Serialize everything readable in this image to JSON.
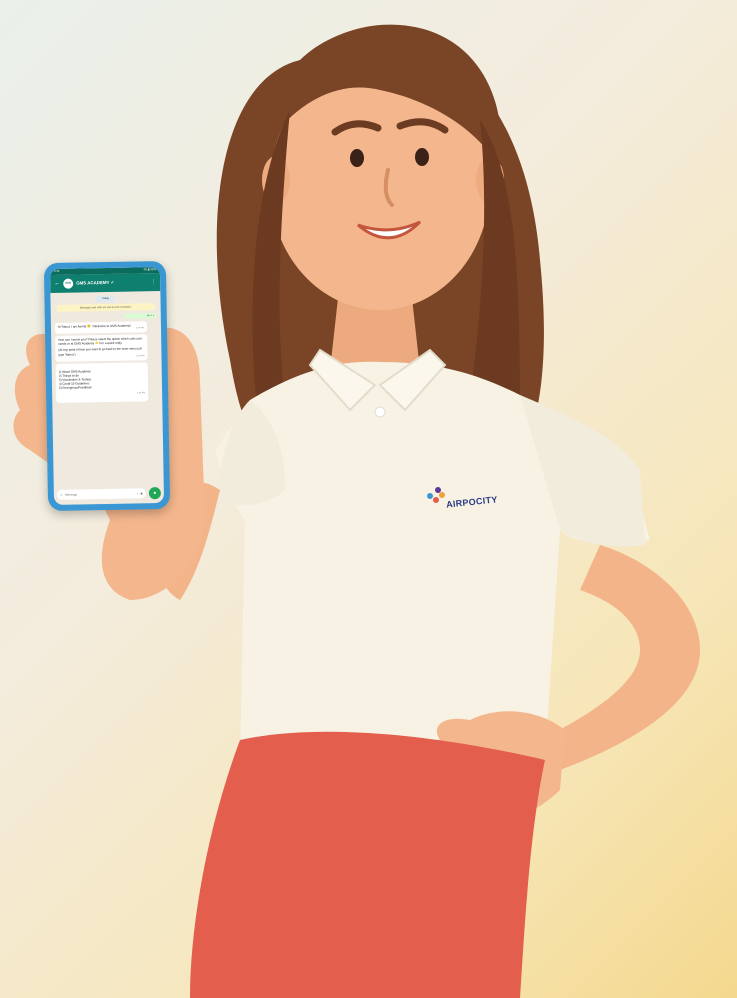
{
  "image": {
    "description_colors": {
      "background_start": "#eaf0ea",
      "background_end": "#f4d88e",
      "skin": "#f3b48a",
      "hair": "#7a4426",
      "shirt": "#f7f2e4",
      "skirt": "#e35e4c",
      "phone_case": "#3a97d4"
    }
  },
  "phone": {
    "status_time": "2:44",
    "status_right": "4G ▮ 93%",
    "chat_name": "GMS ACADEMY ✓",
    "avatar_text": "GMS",
    "date_chip": "Today",
    "notice": "Messages and calls are end-to-end encrypted.",
    "sent_message": "Hi ✓✓",
    "messages": [
      {
        "text": "Hi Rahul, I am Amrita 🙂 ! Welcome to GMS Academy!",
        "time": "2:44 PM"
      },
      {
        "text": "How can I assist you? Please select the option which suits your needs or at GMS Academy 👉 For a quick reply.",
        "time": ""
      },
      {
        "text": "(At any point of time you want to go back to the main menu just type \"Menu\")",
        "time": "2:44 PM"
      },
      {
        "text": "1) About GMS Academy\n2) Things to do\n3) Vaccination & Testing\n4) Covid-19 Guidelines\n5) Emergency/Feedback",
        "time": "2:44 PM"
      }
    ],
    "composer_placeholder": "Message",
    "icons": {
      "back": "back-arrow-icon",
      "menu": "kebab-menu-icon",
      "emoji": "emoji-icon",
      "attach": "paperclip-icon",
      "camera": "camera-icon",
      "mic": "microphone-icon"
    }
  },
  "shirt_logo": {
    "text": "AIRPOCITY"
  }
}
